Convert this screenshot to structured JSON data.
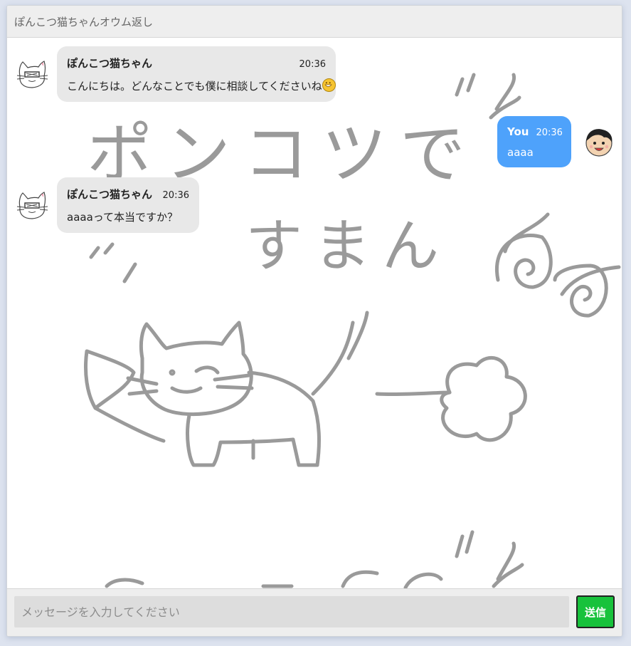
{
  "window": {
    "title": "ぽんこつ猫ちゃんオウム返し"
  },
  "background": {
    "doodle_lines": [
      "ポンコツで",
      "すまん"
    ]
  },
  "messages": [
    {
      "sender": "ぽんこつ猫ちゃん",
      "time": "20:36",
      "text": "こんにちは。どんなことでも僕に相談してくださいね",
      "side": "left",
      "avatar": "cat-avatar-icon",
      "emoji": "grinning-face-icon"
    },
    {
      "sender": "You",
      "time": "20:36",
      "text": "aaaa",
      "side": "right",
      "avatar": "user-avatar-icon"
    },
    {
      "sender": "ぽんこつ猫ちゃん",
      "time": "20:36",
      "text": "aaaaって本当ですか？",
      "side": "left",
      "avatar": "cat-avatar-icon"
    }
  ],
  "composer": {
    "placeholder": "メッセージを入力してください",
    "send_label": "送信"
  },
  "colors": {
    "user_bubble": "#4ea2fb",
    "bot_bubble": "#e8e8e8",
    "send_button": "#18c23c",
    "doodle": "#9a9a9a"
  }
}
